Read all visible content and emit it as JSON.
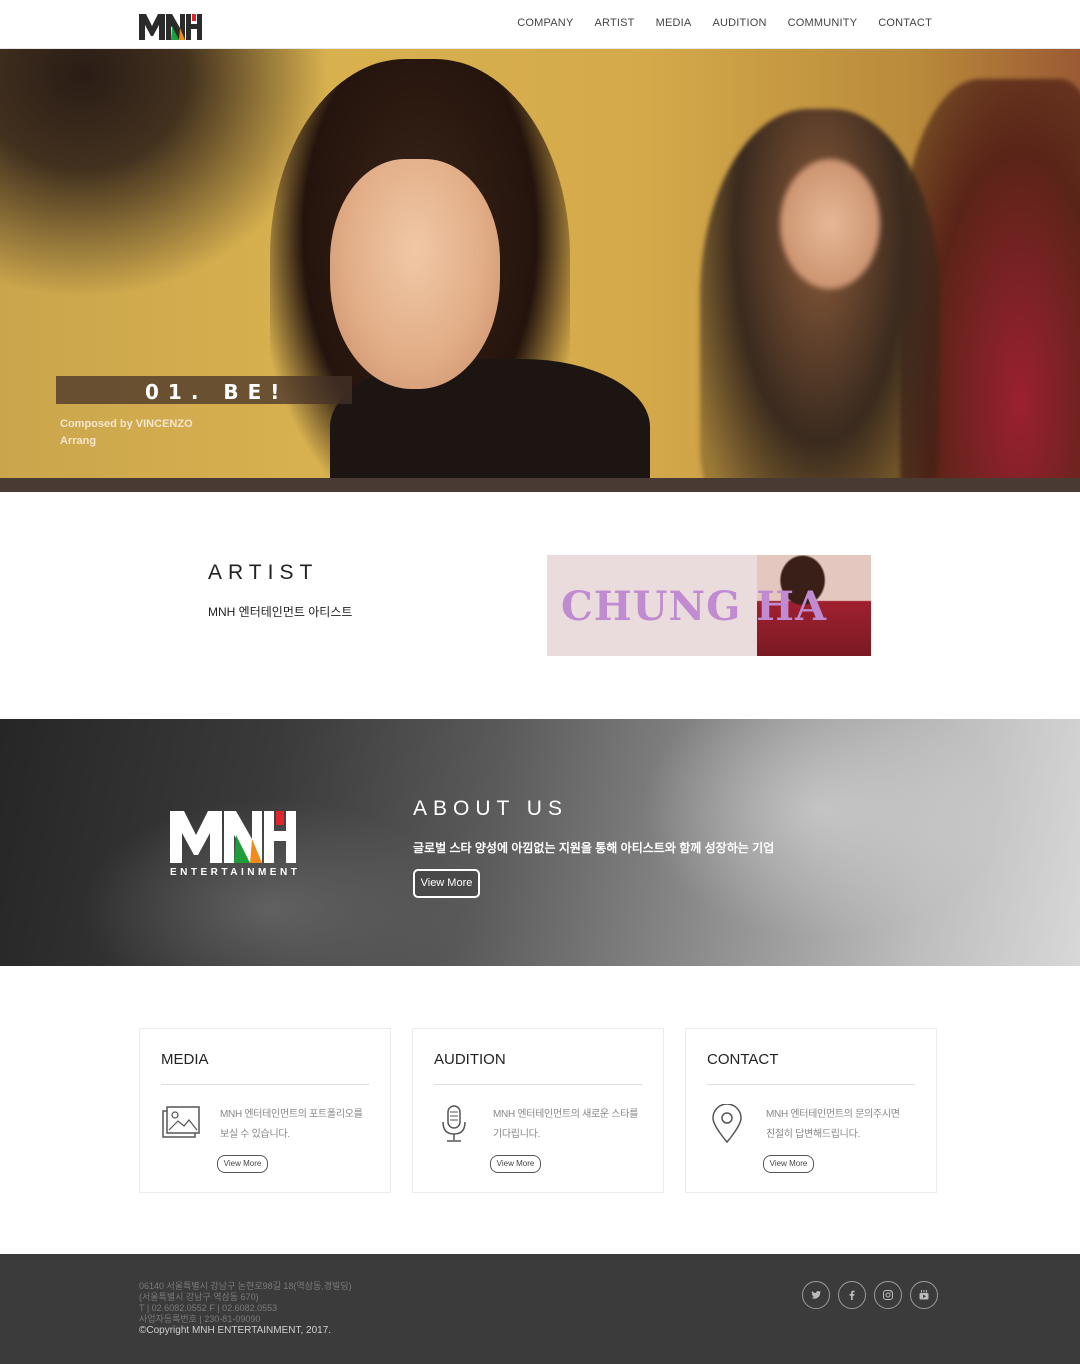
{
  "header": {
    "logo_text": "MNH",
    "nav": [
      "COMPANY",
      "ARTIST",
      "MEDIA",
      "AUDITION",
      "COMMUNITY",
      "CONTACT"
    ]
  },
  "hero": {
    "track_title": "01. BE!",
    "composed_line": "Composed by VINCENZO",
    "arrang_line": "Arrang"
  },
  "artist": {
    "title": "ARTIST",
    "subtitle": "MNH 엔터테인먼트 아티스트",
    "banner_text": "CHUNG HA"
  },
  "about": {
    "logo_text": "MNH",
    "logo_sub": "ENTERTAINMENT",
    "title": "ABOUT US",
    "description": "글로벌 스타 양성에 아낌없는 지원을 통해 아티스트와 함께 성장하는 기업",
    "button": "View More"
  },
  "cards": [
    {
      "title": "MEDIA",
      "line1": "MNH 엔터테인먼트의 포트폴리오를",
      "line2": "보실 수 있습니다.",
      "button": "View More",
      "icon": "image-icon"
    },
    {
      "title": "AUDITION",
      "line1": "MNH 엔터테인먼트의 새로운 스타를",
      "line2": "기다립니다.",
      "button": "View More",
      "icon": "microphone-icon"
    },
    {
      "title": "CONTACT",
      "line1": "MNH 엔터테인먼트의 문의주시면",
      "line2": "친절히 답변해드립니다.",
      "button": "View More",
      "icon": "map-pin-icon"
    }
  ],
  "footer": {
    "address": "06140 서울특별시 강남구 논현로98길 18(역삼동,경빌딩)",
    "old_address": "(서울특별시 강남구 역삼동 670)",
    "phone": "T | 02.6082.0552 F | 02.6082.0553",
    "biz_no": "사업자등록번호 | 230-81-09090",
    "copyright": "©Copyright MNH ENTERTAINMENT, 2017.",
    "social": [
      "twitter-icon",
      "facebook-icon",
      "instagram-icon",
      "youtube-icon"
    ]
  },
  "colors": {
    "logo_green": "#1e9e3a",
    "logo_orange": "#f08a1c",
    "logo_red": "#e0262c",
    "footer_bg": "#3b3b3b"
  }
}
